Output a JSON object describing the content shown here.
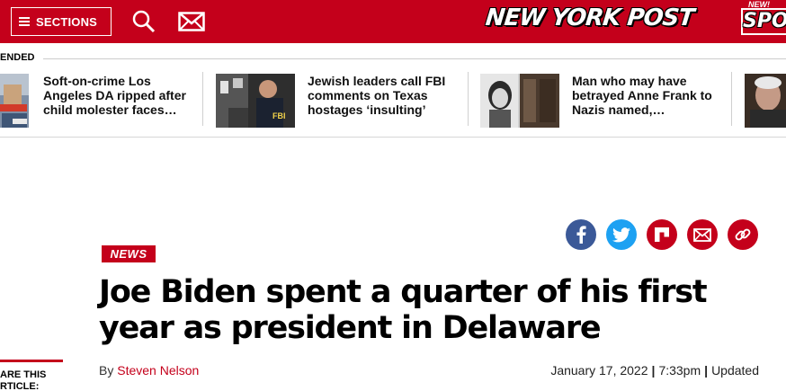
{
  "header": {
    "sections_label": "SECTIONS",
    "logo_text": "NEW YORK POST",
    "promo": {
      "badge": "NEW!",
      "word": "SPO"
    },
    "accent_color": "#c4001b"
  },
  "trending": {
    "label": "ENDED",
    "items": [
      {
        "title": "Soft-on-crime Los Angeles DA ripped after child molester faces…"
      },
      {
        "title": "Jewish leaders call FBI comments on Texas hostages ‘insulting’",
        "thumb_text": "FBI"
      },
      {
        "title": "Man who may have betrayed Anne Frank to Nazis named,…"
      }
    ]
  },
  "share": {
    "icons": [
      "facebook-icon",
      "twitter-icon",
      "flipboard-icon",
      "email-icon",
      "link-icon"
    ],
    "sidebar_label_line1": "ARE THIS",
    "sidebar_label_line2": "RTICLE:"
  },
  "article": {
    "tag": "NEWS",
    "headline": "Joe Biden spent a quarter of his first year as president in Delaware",
    "by_prefix": "By",
    "author": "Steven Nelson",
    "date": "January 17, 2022",
    "time": "7:33pm",
    "updated": "Updated"
  }
}
